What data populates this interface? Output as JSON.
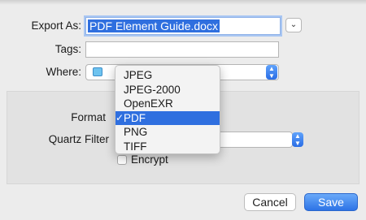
{
  "dialog": {
    "export_as_label": "Export As:",
    "export_as_value": "PDF Element Guide.docx",
    "tags_label": "Tags:",
    "tags_value": "",
    "where_label": "Where:",
    "expand_icon": "chevron-down-icon"
  },
  "options": {
    "format_label": "Format",
    "quartz_filter_label": "Quartz Filter",
    "encrypt_label": "Encrypt",
    "encrypt_checked": false
  },
  "format_menu": {
    "items": [
      "JPEG",
      "JPEG-2000",
      "OpenEXR",
      "PDF",
      "PNG",
      "TIFF"
    ],
    "selected": "PDF",
    "check_glyph": "✓"
  },
  "buttons": {
    "cancel_label": "Cancel",
    "save_label": "Save"
  },
  "colors": {
    "accent": "#2f6fdf",
    "window_bg": "#ececec"
  }
}
